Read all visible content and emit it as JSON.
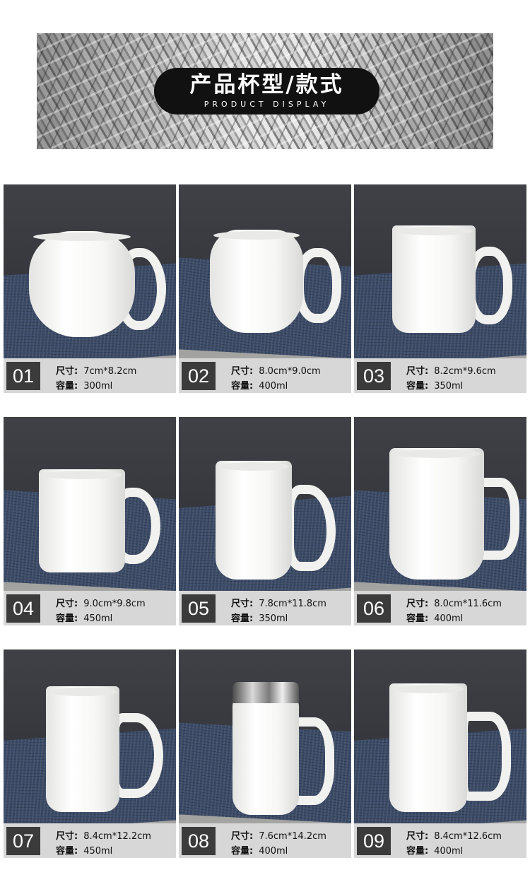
{
  "banner": {
    "title_cn": "产品杯型/款式",
    "title_en": "PRODUCT DISPLAY"
  },
  "labels": {
    "size": "尺寸:",
    "capacity": "容量:"
  },
  "products": [
    {
      "num": "01",
      "size": "7cm*8.2cm",
      "capacity": "300ml"
    },
    {
      "num": "02",
      "size": "8.0cm*9.0cm",
      "capacity": "400ml"
    },
    {
      "num": "03",
      "size": "8.2cm*9.6cm",
      "capacity": "350ml"
    },
    {
      "num": "04",
      "size": "9.0cm*9.8cm",
      "capacity": "450ml"
    },
    {
      "num": "05",
      "size": "7.8cm*11.8cm",
      "capacity": "350ml"
    },
    {
      "num": "06",
      "size": "8.0cm*11.6cm",
      "capacity": "400ml"
    },
    {
      "num": "07",
      "size": "8.4cm*12.2cm",
      "capacity": "450ml"
    },
    {
      "num": "08",
      "size": "7.6cm*14.2cm",
      "capacity": "400ml"
    },
    {
      "num": "09",
      "size": "8.4cm*12.6cm",
      "capacity": "400ml"
    }
  ]
}
